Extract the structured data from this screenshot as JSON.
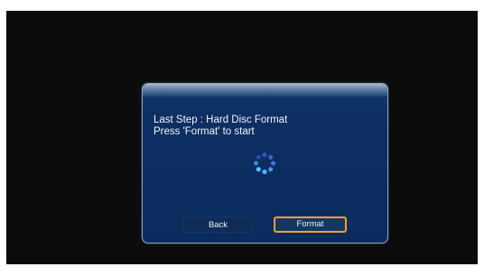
{
  "dialog": {
    "line1": "Last Step : Hard Disc Format",
    "line2": "Press 'Format' to start"
  },
  "buttons": {
    "back_label": "Back",
    "format_label": "Format"
  },
  "colors": {
    "screen_bg": "#0c0c0c",
    "dialog_bg": "#0a2b5d",
    "focus_border": "#f2a12a",
    "spinner_light": "#4fc3ff",
    "spinner_dark": "#3b5ec9"
  },
  "icons": {
    "spinner": "loading-spinner-icon"
  }
}
